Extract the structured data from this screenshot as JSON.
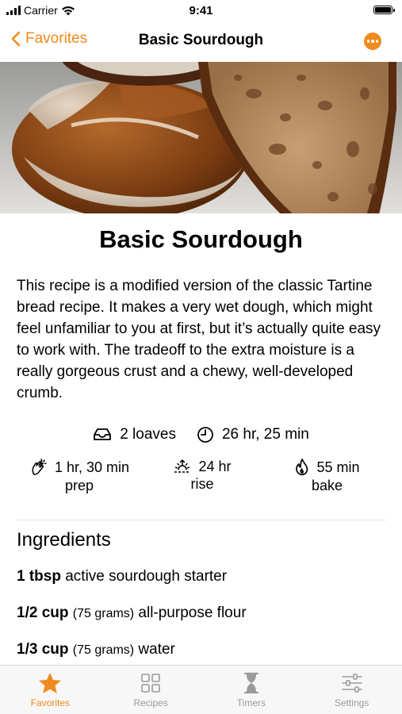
{
  "status_bar": {
    "carrier": "Carrier",
    "time": "9:41",
    "battery_level": 1.0
  },
  "nav": {
    "back_label": "Favorites",
    "title": "Basic Sourdough"
  },
  "recipe": {
    "title": "Basic Sourdough",
    "description": "This recipe is a modified version of the classic Tartine bread recipe. It makes a very wet dough, which might feel unfamiliar to you at first, but it’s actually quite easy to work with. The tradeoff to the extra moisture is a really gorgeous crust and a chewy, well-developed crumb.",
    "yield": "2 loaves",
    "total_time": "26 hr, 25 min",
    "stats": [
      {
        "value": "1 hr, 30 min",
        "label": "prep",
        "icon": "hands-clapping-icon"
      },
      {
        "value": "24 hr",
        "label": "rise",
        "icon": "sunrise-icon"
      },
      {
        "value": "55 min",
        "label": "bake",
        "icon": "flame-icon"
      }
    ]
  },
  "ingredients": {
    "heading": "Ingredients",
    "items": [
      {
        "qty": "1 tbsp",
        "grams": "",
        "name": "active sourdough starter"
      },
      {
        "qty": "1/2 cup",
        "grams": "(75 grams)",
        "name": "all-purpose flour"
      },
      {
        "qty": "1/3 cup",
        "grams": "(75 grams)",
        "name": "water"
      }
    ]
  },
  "tabs": [
    {
      "label": "Favorites",
      "icon": "star-icon",
      "active": true
    },
    {
      "label": "Recipes",
      "icon": "grid-icon",
      "active": false
    },
    {
      "label": "Timers",
      "icon": "hourglass-icon",
      "active": false
    },
    {
      "label": "Settings",
      "icon": "sliders-icon",
      "active": false
    }
  ],
  "colors": {
    "accent": "#f08a1c",
    "inactive": "#9a9a9a"
  }
}
